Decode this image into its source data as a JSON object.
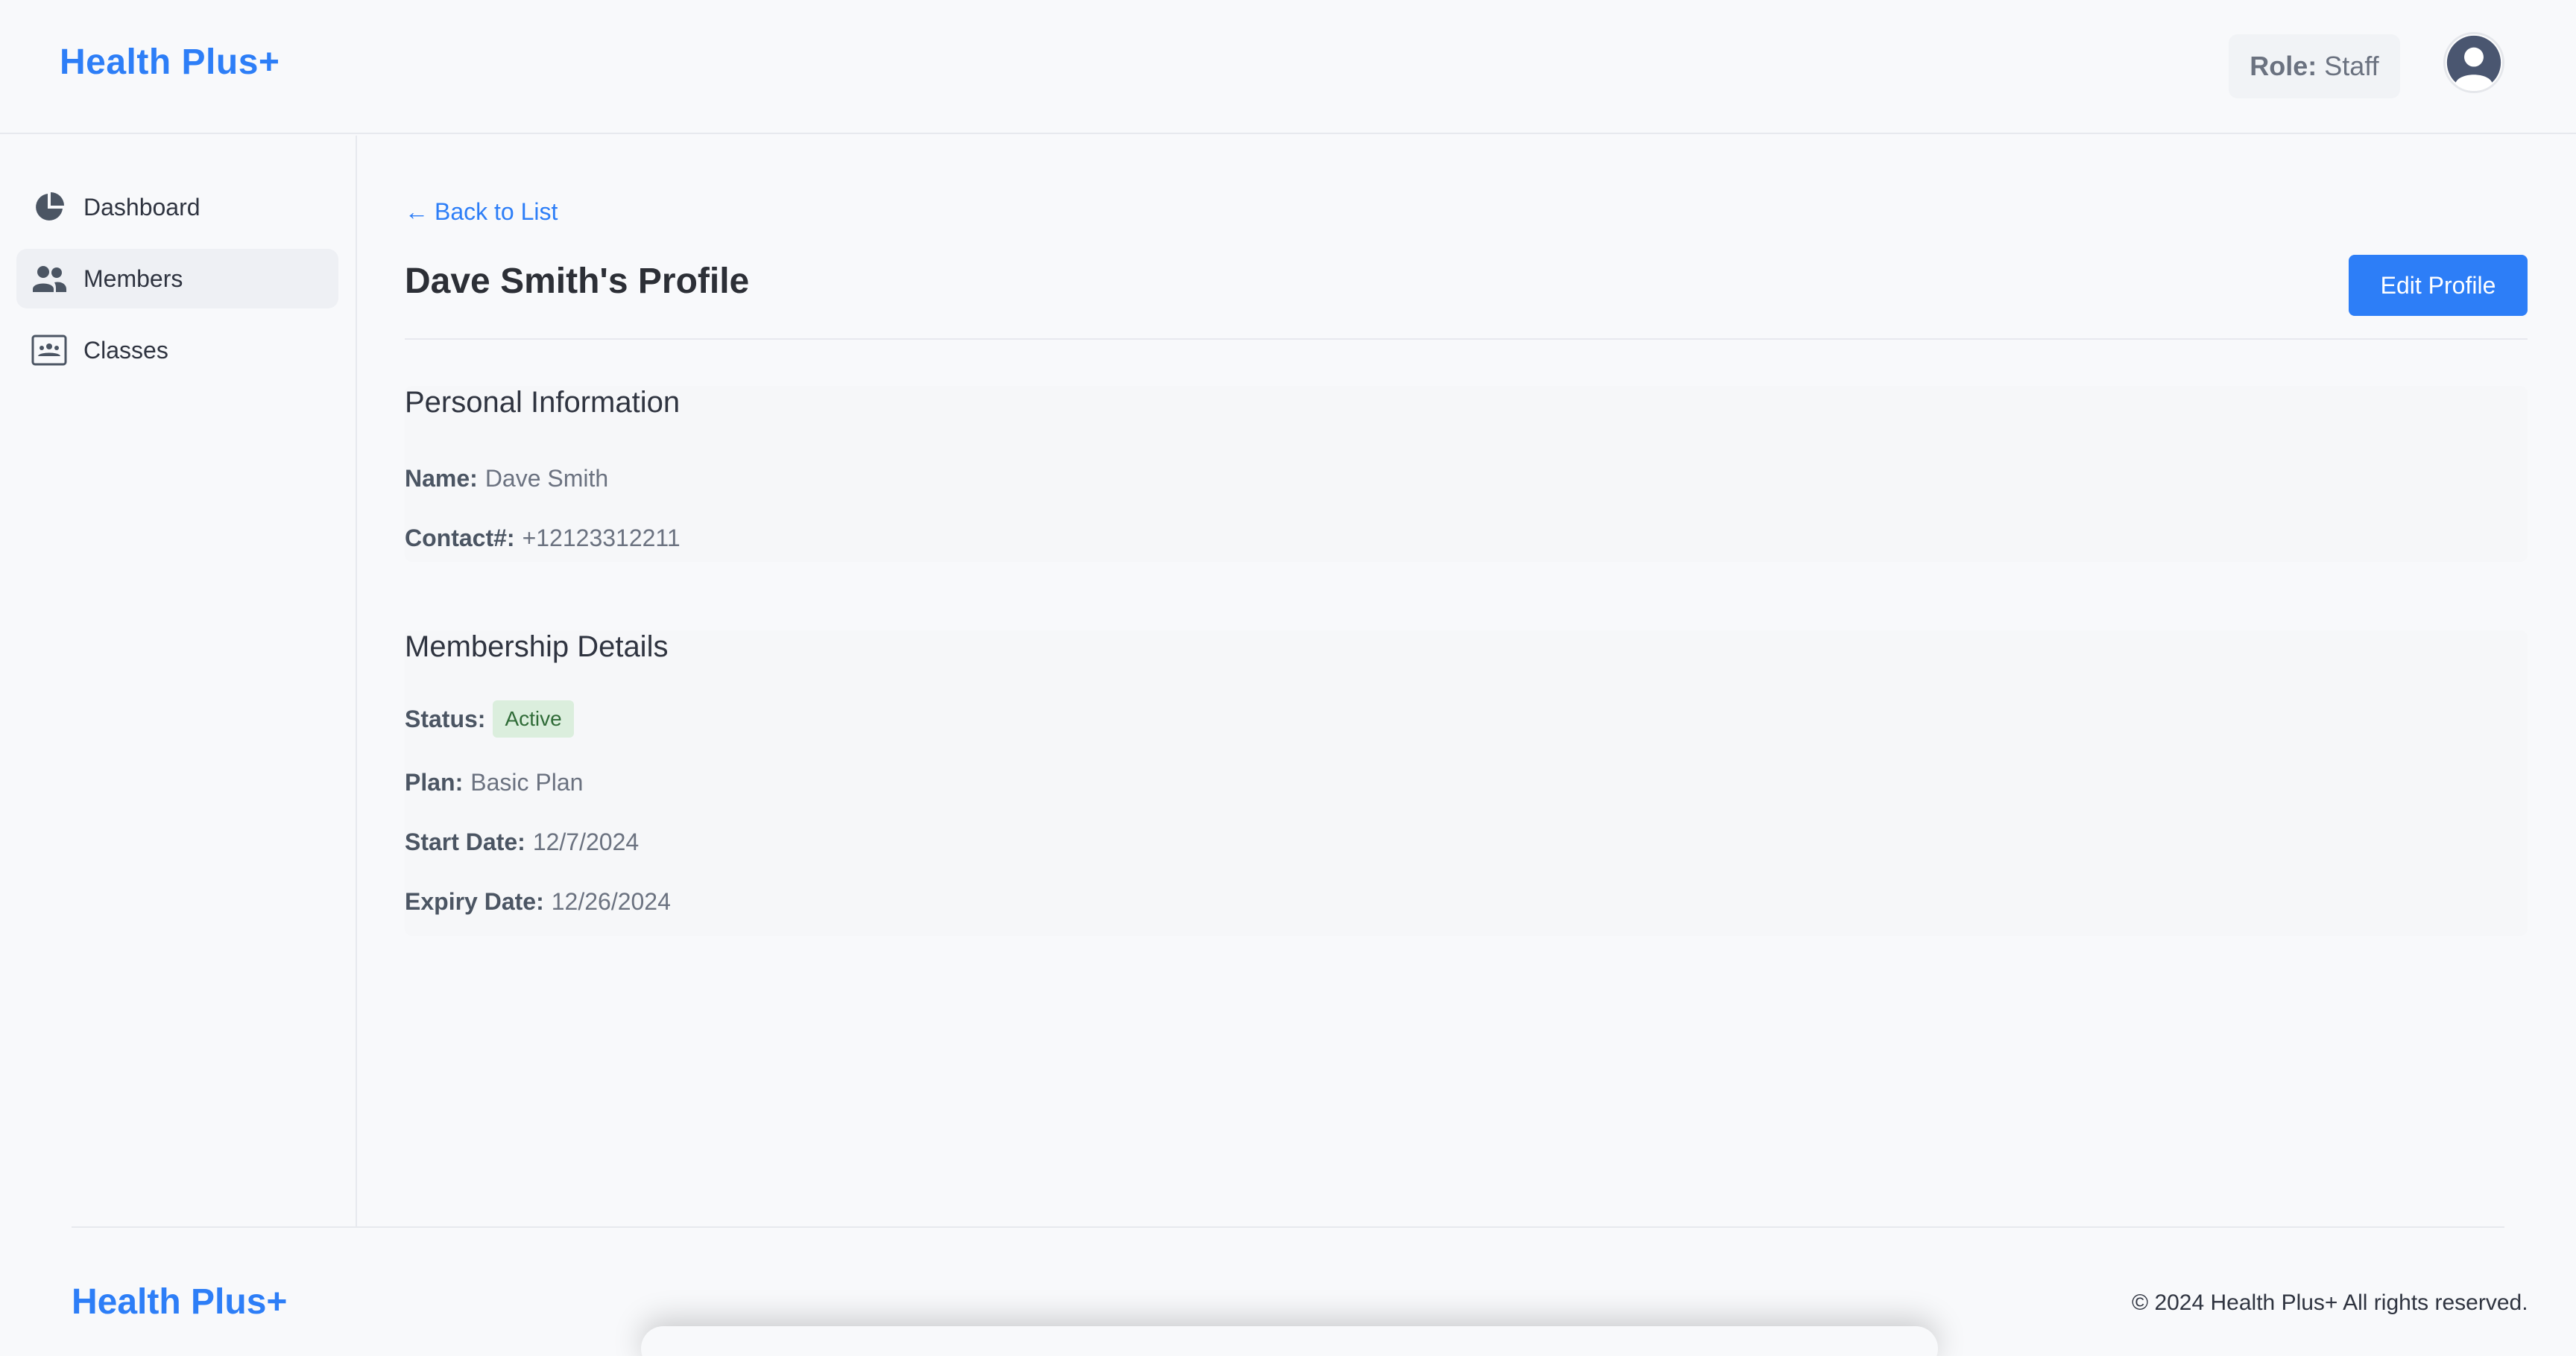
{
  "header": {
    "brand": "Health Plus+",
    "role_label": "Role:",
    "role_value": "Staff",
    "avatar_icon": "user-avatar-icon"
  },
  "sidebar": {
    "items": [
      {
        "label": "Dashboard",
        "icon": "pie-chart-icon",
        "active": false
      },
      {
        "label": "Members",
        "icon": "users-icon",
        "active": true
      },
      {
        "label": "Classes",
        "icon": "classroom-icon",
        "active": false
      }
    ]
  },
  "main": {
    "back_label": "Back to List",
    "back_arrow": "←",
    "title": "Dave Smith's Profile",
    "edit_label": "Edit Profile",
    "personal": {
      "title": "Personal Information",
      "name_label": "Name:",
      "name_value": "Dave Smith",
      "contact_label": "Contact#:",
      "contact_value": "+12123312211"
    },
    "membership": {
      "title": "Membership Details",
      "status_label": "Status:",
      "status_value": "Active",
      "plan_label": "Plan:",
      "plan_value": "Basic Plan",
      "start_label": "Start Date:",
      "start_value": "12/7/2024",
      "expiry_label": "Expiry Date:",
      "expiry_value": "12/26/2024"
    }
  },
  "footer": {
    "brand": "Health Plus+",
    "copyright": "© 2024 Health Plus+ All rights reserved."
  },
  "colors": {
    "accent": "#2d7ef7",
    "background": "#f8f9fb",
    "badge_bg": "#dbeedd",
    "badge_text": "#2f6b37"
  }
}
